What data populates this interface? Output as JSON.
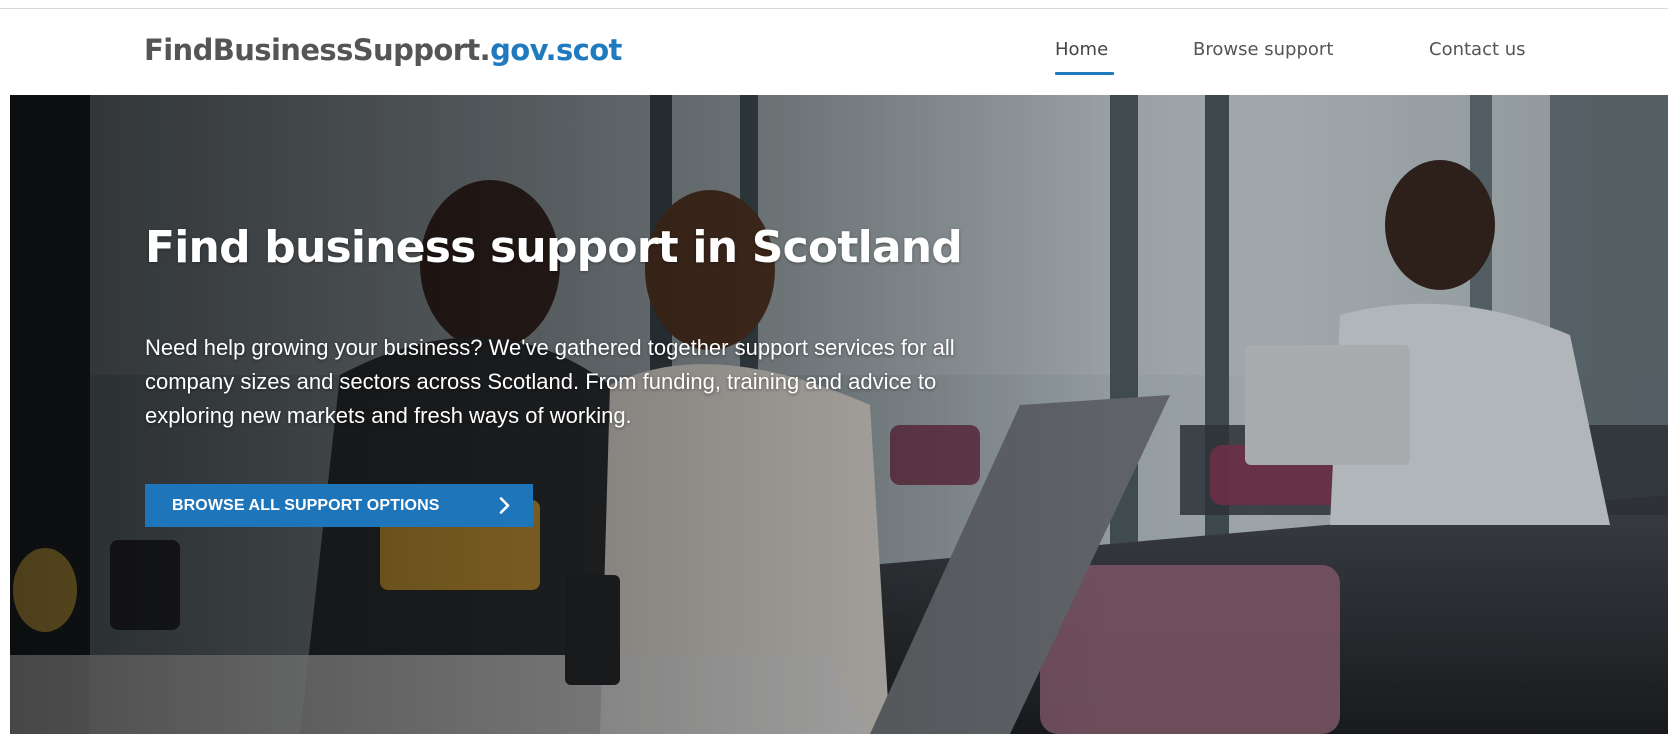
{
  "header": {
    "logo_main": "FindBusinessSupport.",
    "logo_domain": "gov.scot",
    "nav": [
      {
        "label": "Home",
        "active": true
      },
      {
        "label": "Browse support",
        "active": false
      },
      {
        "label": "Contact us",
        "active": false
      }
    ]
  },
  "hero": {
    "title": "Find business support in Scotland",
    "description": "Need help growing your business? We've gathered together support services for all company sizes and sectors across Scotland. From funding, training and advice to exploring new markets and fresh ways of working.",
    "cta_label": "BROWSE ALL SUPPORT OPTIONS",
    "cta_icon": "chevron-right-icon",
    "background_image": "office-lounge-photo"
  },
  "colors": {
    "brand_blue": "#1f7ac0",
    "button_blue": "#1f75ba",
    "nav_text": "#555555"
  }
}
